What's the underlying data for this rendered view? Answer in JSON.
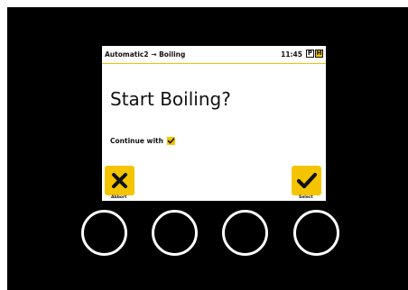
{
  "header": {
    "breadcrumb": "Automatic2 → Boiling",
    "time": "11:45",
    "badge_p": "P",
    "badge_h": "H"
  },
  "dialog": {
    "title": "Start Boiling?",
    "continue_label": "Continue with"
  },
  "softkeys": {
    "abort_label": "Abbort",
    "select_label": "Select"
  },
  "colors": {
    "accent": "#f5c400",
    "screen_bg": "#ffffff",
    "device_bg": "#000000"
  },
  "icons": {
    "abort": "close-icon",
    "select": "checkmark-icon",
    "continue": "checkmark-icon"
  }
}
